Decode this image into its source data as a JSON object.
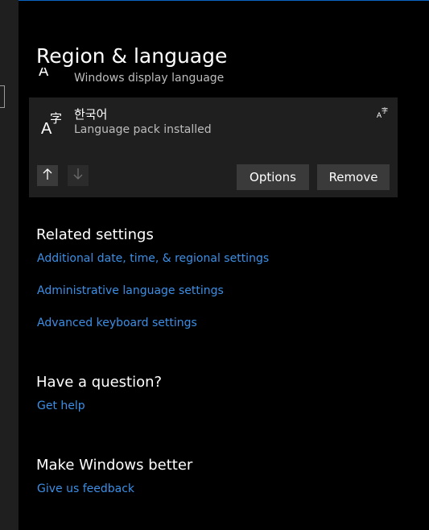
{
  "window": {
    "accent_color": "#0a64c2"
  },
  "page": {
    "title": "Region & language"
  },
  "scrolled_item": {
    "glyph": "A",
    "text": "Windows display language"
  },
  "language_card": {
    "name": "한국어",
    "status": "Language pack installed",
    "icon": "language-icon",
    "feature_icon": "display-language-feature-icon",
    "move_up_icon": "arrow-up-icon",
    "move_down_icon": "arrow-down-icon",
    "options_label": "Options",
    "remove_label": "Remove"
  },
  "related_settings": {
    "heading": "Related settings",
    "links": [
      "Additional date, time, & regional settings",
      "Administrative language settings",
      "Advanced keyboard settings"
    ]
  },
  "question": {
    "heading": "Have a question?",
    "link": "Get help"
  },
  "feedback": {
    "heading": "Make Windows better",
    "link": "Give us feedback"
  },
  "colors": {
    "background": "#000000",
    "pane": "#1f1f1f",
    "card": "#1f1f1f",
    "button": "#3a3a3a",
    "link": "#3c8fe5",
    "secondary_text": "#bdbdbd"
  }
}
